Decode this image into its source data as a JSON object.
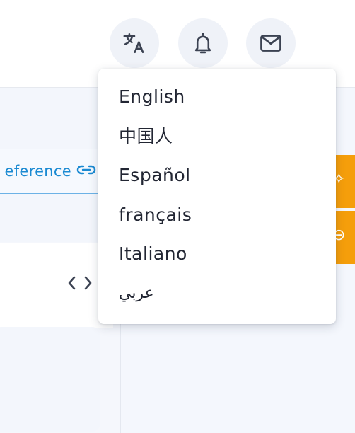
{
  "header": {
    "translate_icon": "translate-icon",
    "notification_icon": "bell-icon",
    "mail_icon": "mail-icon"
  },
  "content": {
    "reference_label": "eference",
    "reference_icon": "link-icon",
    "code_icon": "code-brackets-icon"
  },
  "language_menu": {
    "items": [
      {
        "label": "English"
      },
      {
        "label": "中国人"
      },
      {
        "label": "Español"
      },
      {
        "label": "français"
      },
      {
        "label": "Italiano"
      },
      {
        "label": "عربي"
      }
    ]
  },
  "colors": {
    "accent_blue": "#1b8ad2",
    "orange": "#f59e0b",
    "icon_bg": "#eff2f8",
    "text": "#222633"
  }
}
